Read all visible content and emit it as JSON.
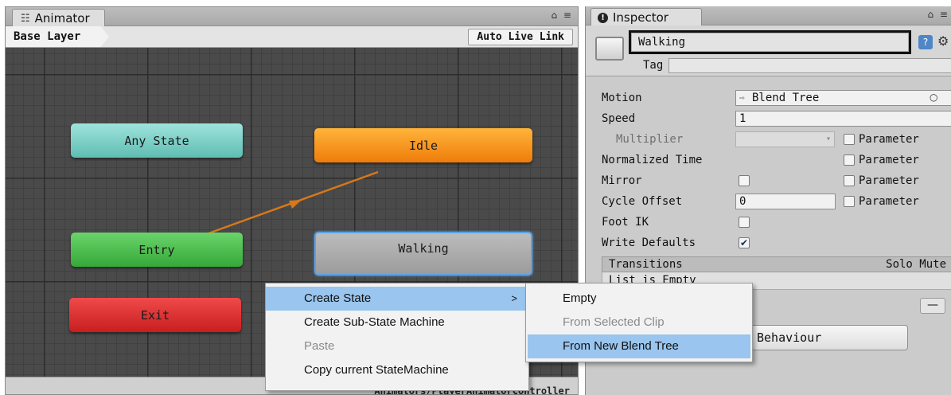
{
  "animator": {
    "tab_title": "Animator",
    "tab_icon": "animator-icon",
    "window_controls": "⌂ ≡",
    "breadcrumb": "Base Layer",
    "live_link_label": "Auto Live Link",
    "status_path": "Animators/PlayerAnimatorController",
    "nodes": {
      "any_state": "Any State",
      "entry": "Entry",
      "exit": "Exit",
      "idle": "Idle",
      "walking": "Walking"
    },
    "colors": {
      "any_state": "#6cc8bd",
      "entry": "#44b848",
      "exit": "#dc2a2a",
      "idle": "#f78f1e",
      "walking": "#ababab",
      "transition": "#d8781a",
      "selection": "#5aa3e6"
    }
  },
  "inspector": {
    "tab_title": "Inspector",
    "tab_icon": "info-icon",
    "window_controls": "⌂ ≡",
    "state_name": "Walking",
    "tag_label": "Tag",
    "tag_value": "",
    "properties": {
      "motion_label": "Motion",
      "motion_value": "Blend Tree",
      "motion_icon": "blend-tree-icon",
      "speed_label": "Speed",
      "speed_value": "1",
      "multiplier_label": "Multiplier",
      "normalized_time_label": "Normalized Time",
      "mirror_label": "Mirror",
      "cycle_offset_label": "Cycle Offset",
      "cycle_offset_value": "0",
      "foot_ik_label": "Foot IK",
      "write_defaults_label": "Write Defaults",
      "parameter_label": "Parameter",
      "mirror_checked": false,
      "foot_ik_checked": false,
      "write_defaults_checked": true
    },
    "transitions_label": "Transitions",
    "solo_mute_label": "Solo Mute",
    "list_empty_label": "List is Empty",
    "minus_label": "—",
    "add_behaviour_label": "Behaviour"
  },
  "context_menu": {
    "items": [
      {
        "label": "Create State",
        "highlighted": true,
        "has_submenu": true,
        "enabled": true
      },
      {
        "label": "Create Sub-State Machine",
        "highlighted": false,
        "has_submenu": false,
        "enabled": true
      },
      {
        "label": "Paste",
        "highlighted": false,
        "has_submenu": false,
        "enabled": false
      },
      {
        "label": "Copy current StateMachine",
        "highlighted": false,
        "has_submenu": false,
        "enabled": true
      }
    ],
    "submenu_arrow": ">"
  },
  "submenu": {
    "items": [
      {
        "label": "Empty",
        "highlighted": false,
        "enabled": true
      },
      {
        "label": "From Selected Clip",
        "highlighted": false,
        "enabled": false
      },
      {
        "label": "From New Blend Tree",
        "highlighted": true,
        "enabled": true
      }
    ]
  }
}
